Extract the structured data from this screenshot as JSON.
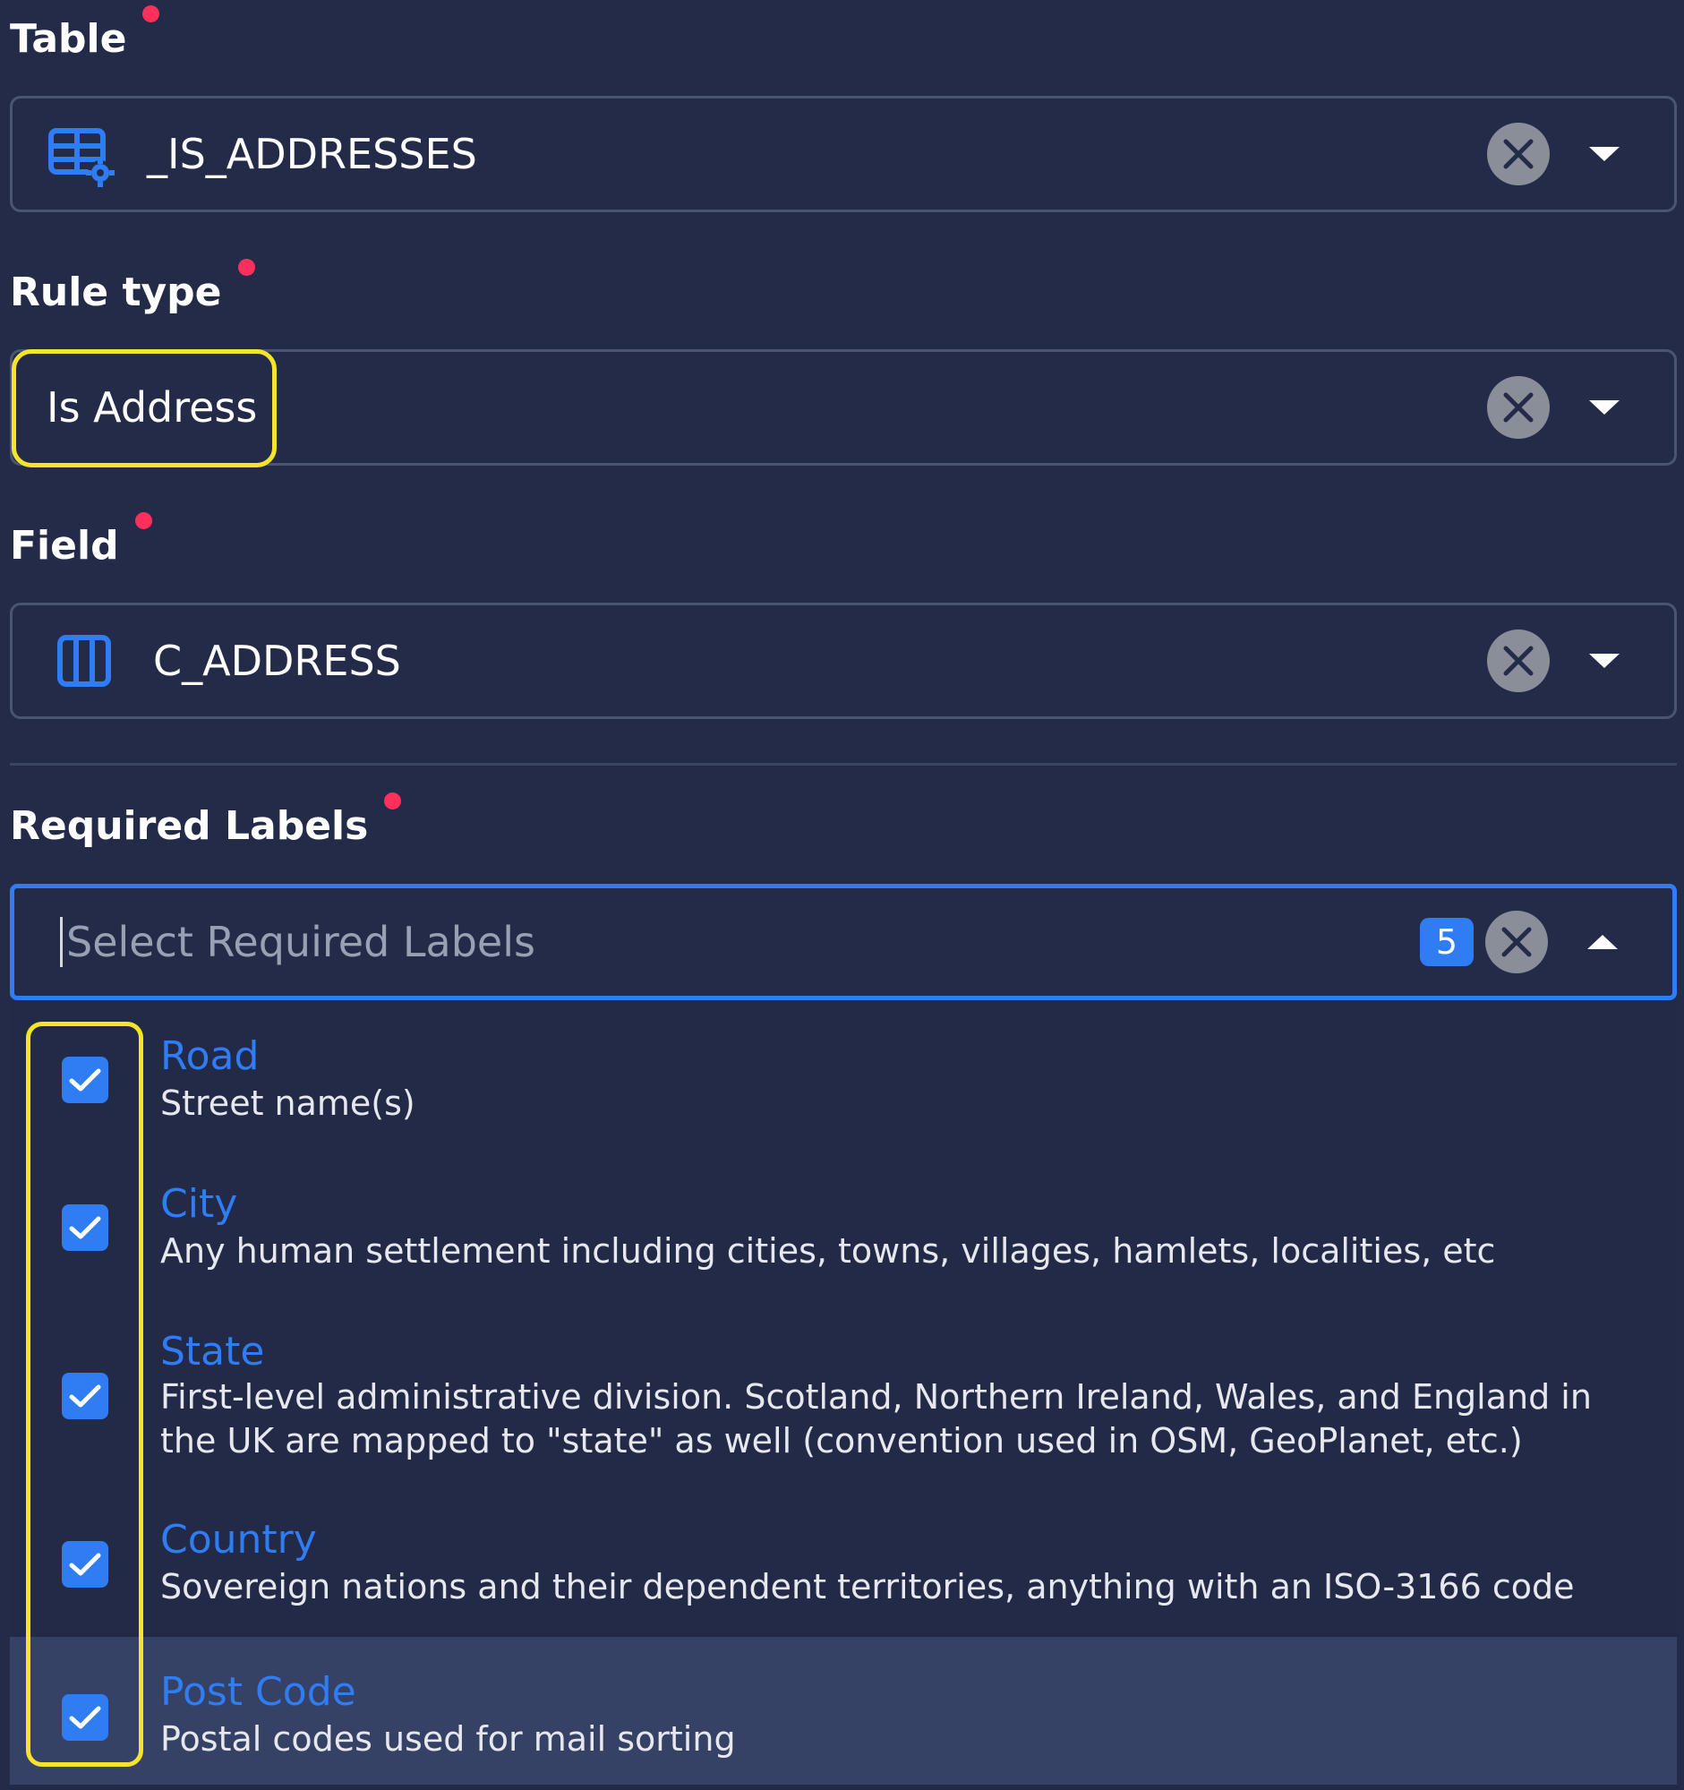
{
  "table_field": {
    "label": "Table",
    "value": "_IS_ADDRESSES",
    "icon": "table-settings-icon"
  },
  "rule_type_field": {
    "label": "Rule type",
    "value": "Is Address"
  },
  "field_field": {
    "label": "Field",
    "value": "C_ADDRESS",
    "icon": "column-icon"
  },
  "required_labels_field": {
    "label": "Required Labels",
    "placeholder": "Select Required Labels",
    "selected_count": "5"
  },
  "options": [
    {
      "title": "Road",
      "description": "Street name(s)",
      "checked": true
    },
    {
      "title": "City",
      "description": "Any human settlement including cities, towns, villages, hamlets, localities, etc",
      "checked": true
    },
    {
      "title": "State",
      "description": "First-level administrative division. Scotland, Northern Ireland, Wales, and England in the UK are mapped to \"state\" as well (convention used in OSM, GeoPlanet, etc.)",
      "checked": true
    },
    {
      "title": "Country",
      "description": "Sovereign nations and their dependent territories, anything with an ISO-3166 code",
      "checked": true
    },
    {
      "title": "Post Code",
      "description": "Postal codes used for mail sorting",
      "checked": true
    }
  ],
  "colors": {
    "background": "#232b48",
    "accent": "#2f7cf3",
    "required_dot": "#ff2f5c",
    "highlight": "#f5e52a"
  }
}
